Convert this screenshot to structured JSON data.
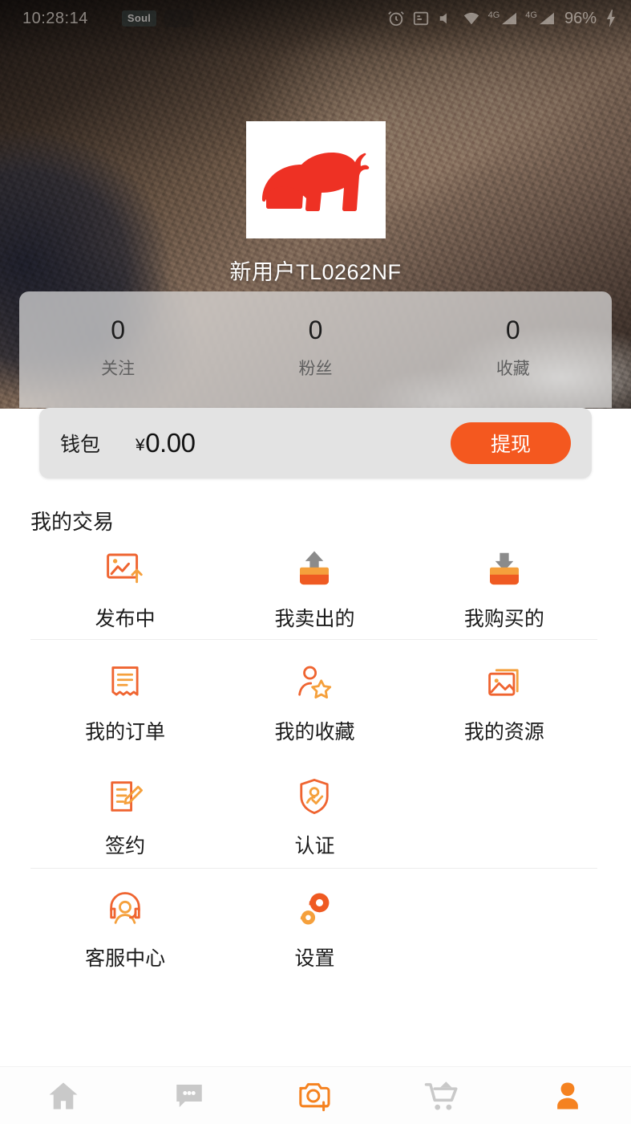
{
  "status_bar": {
    "time": "10:28:14",
    "app_badge": "Soul",
    "network_1": "4G",
    "network_2": "4G",
    "battery": "96%",
    "icons": [
      "alarm-icon",
      "screenshot-icon",
      "mute-icon",
      "wifi-icon",
      "signal-4g-icon",
      "signal-4g-icon",
      "charging-bolt-icon"
    ]
  },
  "profile": {
    "avatar_icon": "red-elephant-logo",
    "username": "新用户TL0262NF",
    "stats": [
      {
        "value": "0",
        "label": "关注"
      },
      {
        "value": "0",
        "label": "粉丝"
      },
      {
        "value": "0",
        "label": "收藏"
      }
    ]
  },
  "wallet": {
    "label": "钱包",
    "currency": "¥",
    "amount": "0.00",
    "withdraw_label": "提现"
  },
  "section": {
    "title": "我的交易"
  },
  "menu": {
    "rows": [
      [
        {
          "label": "发布中",
          "icon": "image-chart-upload-icon"
        },
        {
          "label": "我卖出的",
          "icon": "box-arrow-up-icon"
        },
        {
          "label": "我购买的",
          "icon": "box-arrow-down-icon"
        }
      ],
      [
        {
          "label": "我的订单",
          "icon": "receipt-icon"
        },
        {
          "label": "我的收藏",
          "icon": "person-star-icon"
        },
        {
          "label": "我的资源",
          "icon": "image-stack-icon"
        }
      ],
      [
        {
          "label": "签约",
          "icon": "document-pen-icon"
        },
        {
          "label": "认证",
          "icon": "shield-person-check-icon"
        },
        {
          "label": "",
          "icon": ""
        }
      ],
      [
        {
          "label": "客服中心",
          "icon": "headset-person-icon"
        },
        {
          "label": "设置",
          "icon": "gears-icon"
        },
        {
          "label": "",
          "icon": ""
        }
      ]
    ]
  },
  "bottom_nav": [
    {
      "icon": "home-icon",
      "active": false
    },
    {
      "icon": "chat-bubble-icon",
      "active": false
    },
    {
      "icon": "camera-add-icon",
      "active": true
    },
    {
      "icon": "shopping-cart-icon",
      "active": false
    },
    {
      "icon": "profile-person-icon",
      "active": true
    }
  ],
  "colors": {
    "accent_orange": "#f4581f",
    "icon_orange": "#f07b2a",
    "logo_red": "#ee3124",
    "nav_inactive": "#c9c9c9",
    "card_gray": "#e3e3e3"
  }
}
